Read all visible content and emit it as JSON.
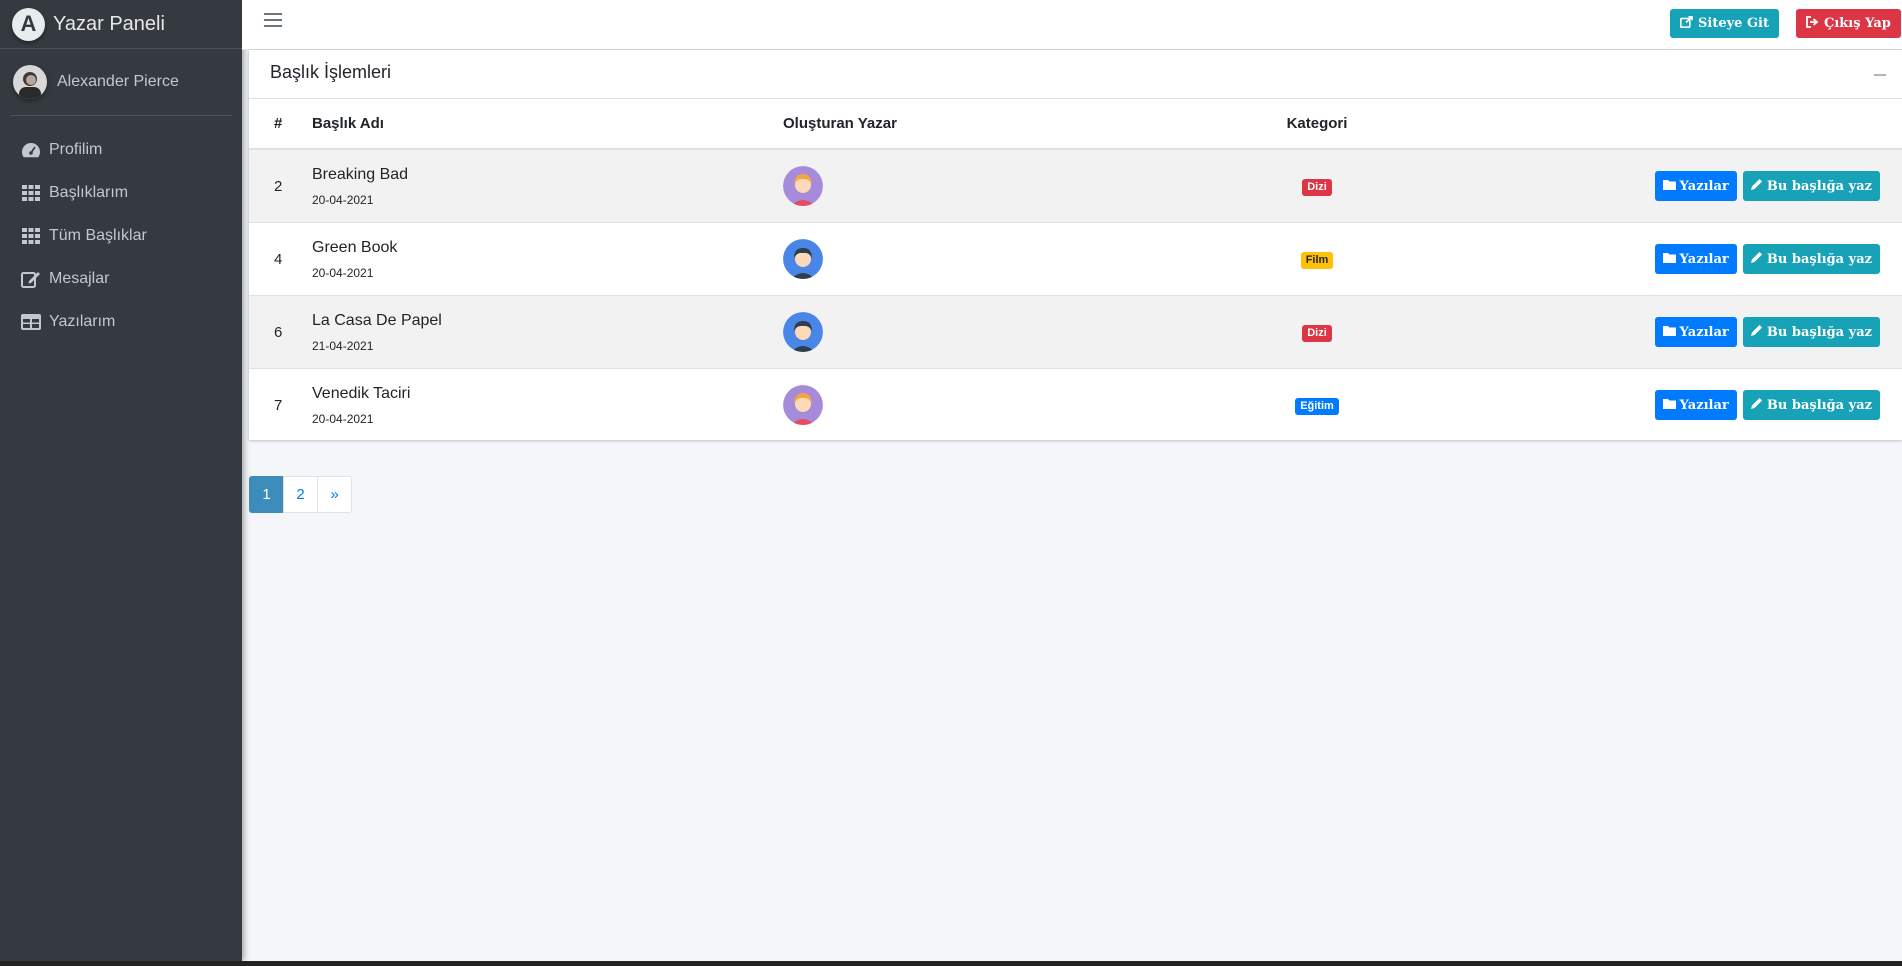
{
  "sidebar": {
    "brand": "Yazar Paneli",
    "brand_logo_letter": "A",
    "user_name": "Alexander Pierce",
    "items": [
      {
        "label": "Profilim",
        "icon": "tachometer-icon"
      },
      {
        "label": "Başlıklarım",
        "icon": "grid-icon"
      },
      {
        "label": "Tüm Başlıklar",
        "icon": "grid-icon"
      },
      {
        "label": "Mesajlar",
        "icon": "edit-icon"
      },
      {
        "label": "Yazılarım",
        "icon": "table-icon"
      }
    ]
  },
  "topbar": {
    "site_button": "Siteye Git",
    "logout_button": "Çıkış Yap"
  },
  "card": {
    "title": "Başlık İşlemleri",
    "columns": [
      "#",
      "Başlık Adı",
      "Oluşturan Yazar",
      "Kategori",
      ""
    ],
    "rows": [
      {
        "num": "2",
        "title": "Breaking Bad",
        "date": "20-04-2021",
        "avatar": "female",
        "category": "Dizi",
        "category_color": "#dc3545",
        "category_text_color": "#ffffff"
      },
      {
        "num": "4",
        "title": "Green Book",
        "date": "20-04-2021",
        "avatar": "male",
        "category": "Film",
        "category_color": "#ffc107",
        "category_text_color": "#212529"
      },
      {
        "num": "6",
        "title": "La Casa De Papel",
        "date": "21-04-2021",
        "avatar": "male",
        "category": "Dizi",
        "category_color": "#dc3545",
        "category_text_color": "#ffffff"
      },
      {
        "num": "7",
        "title": "Venedik Taciri",
        "date": "20-04-2021",
        "avatar": "female",
        "category": "Eğitim",
        "category_color": "#007bff",
        "category_text_color": "#ffffff"
      }
    ],
    "action_posts": "Yazılar",
    "action_write": "Bu başlığa yaz"
  },
  "pagination": [
    "1",
    "2",
    "»"
  ],
  "colors": {
    "sidebar_bg": "#343a40",
    "primary": "#007bff",
    "info": "#17a2b8",
    "danger": "#dc3545",
    "page_active": "#3c8dbc"
  }
}
